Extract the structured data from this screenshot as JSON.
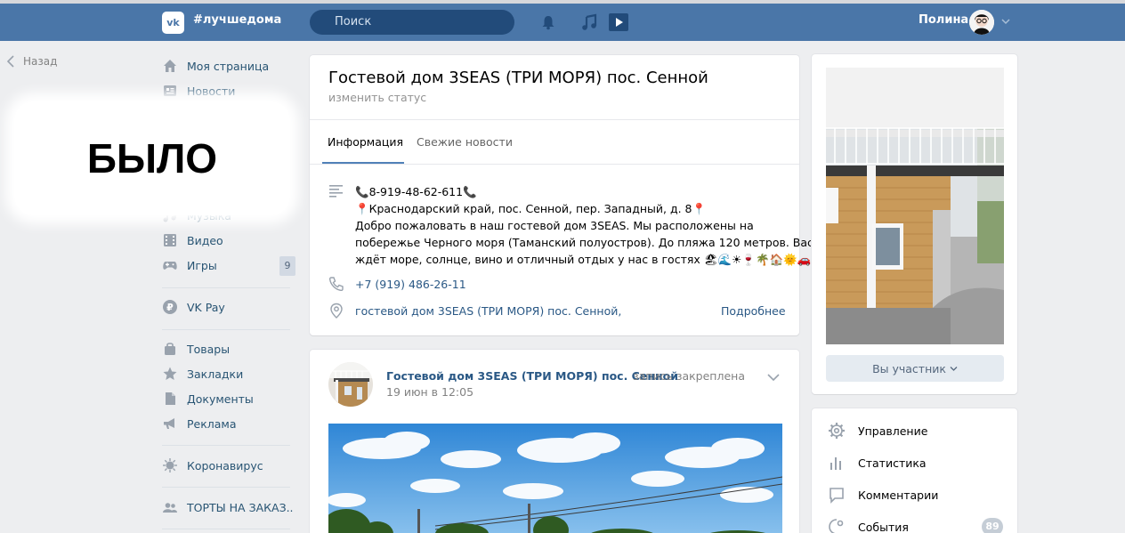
{
  "header": {
    "hashtag": "#лучшедома",
    "search_placeholder": "Поиск",
    "user_name": "Полина",
    "brand_color": "#4a76a8"
  },
  "back": {
    "label": "Назад"
  },
  "sidebar": {
    "items": [
      {
        "label": "Моя страница",
        "icon": "home-icon"
      },
      {
        "label": "Новости",
        "icon": "news-icon"
      },
      {
        "label": "Музыка",
        "icon": "music-icon"
      },
      {
        "label": "Видео",
        "icon": "video-icon"
      },
      {
        "label": "Игры",
        "icon": "gamepad-icon",
        "count": "9"
      },
      {
        "label": "VK Pay",
        "icon": "vkpay-icon"
      },
      {
        "label": "Товары",
        "icon": "bag-icon"
      },
      {
        "label": "Закладки",
        "icon": "star-icon"
      },
      {
        "label": "Документы",
        "icon": "document-icon"
      },
      {
        "label": "Реклама",
        "icon": "megaphone-icon"
      },
      {
        "label": "Коронавирус",
        "icon": "virus-icon"
      },
      {
        "label": "ТОРТЫ НА ЗАКАЗ..",
        "icon": "group-icon"
      }
    ]
  },
  "overlay": {
    "label": "БЫЛО"
  },
  "page": {
    "title": "Гостевой дом 3SEAS (ТРИ МОРЯ) пос. Сенной",
    "status_link": "изменить статус",
    "tabs": [
      "Информация",
      "Свежие новости"
    ],
    "info_lines": [
      "📞8-919-48-62-611📞",
      "📍Краснодарский край, пос. Сенной, пер. Западный, д. 8📍",
      "Добро пожаловать в наш гостевой дом 3SEAS. Мы расположены на",
      "побережье Черного моря (Таманский полуостров). До пляжа 120 метров. Вас",
      "ждёт море, солнце, вино и отличный отдых у нас в гостях 🏖🌊☀🍷🌴🏠🌞🚗.🙋‍♂️🏖🌊"
    ],
    "phone": "+7 (919) 486-26-11",
    "address": "гостевой дом 3SEAS (ТРИ МОРЯ) пос. Сенной,",
    "more_link": "Подробнее"
  },
  "post": {
    "author": "Гостевой дом 3SEAS (ТРИ МОРЯ) пос. Сенной",
    "pinned_text": "запись закреплена",
    "date": "19 июн в 12:05"
  },
  "right": {
    "member_button": "Вы участник",
    "manage_items": [
      {
        "label": "Управление",
        "icon": "gear-icon"
      },
      {
        "label": "Статистика",
        "icon": "stats-icon"
      },
      {
        "label": "Комментарии",
        "icon": "comment-icon"
      },
      {
        "label": "События",
        "icon": "events-icon",
        "count": "89"
      }
    ]
  }
}
